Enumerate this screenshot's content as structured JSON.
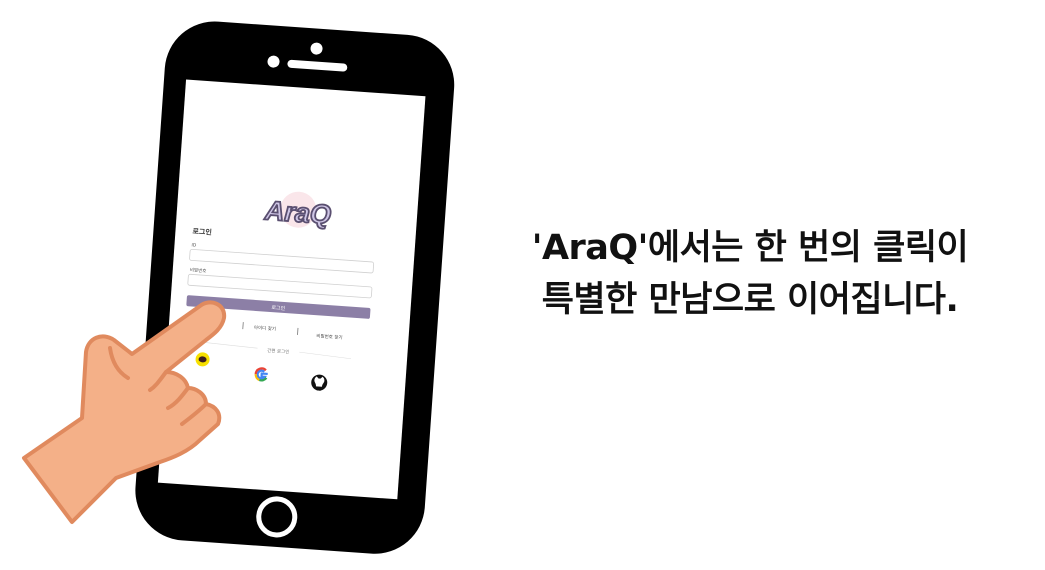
{
  "headline": {
    "line1": "'AraQ'에서는 한 번의 클릭이",
    "line2": "특별한 만남으로 이어집니다."
  },
  "phone_screen": {
    "logo_text": "AraQ",
    "login_title": "로그인",
    "id_label": "ID",
    "password_label": "비밀번호",
    "login_button_label": "로그인",
    "find_id_link": "아이디 찾기",
    "find_password_link": "비밀번호 찾기",
    "social_login_label": "간편 로그인"
  },
  "colors": {
    "phone_body": "#000000",
    "screen": "#ffffff",
    "login_button": "#8c7fa6",
    "logo_fill": "#cfc6e6",
    "kakao_yellow": "#f7e000",
    "hand_skin": "#f4b088",
    "hand_outline": "#e08a5e"
  },
  "icons": [
    "kakao-icon",
    "google-icon",
    "github-icon",
    "pointing-hand-icon"
  ]
}
